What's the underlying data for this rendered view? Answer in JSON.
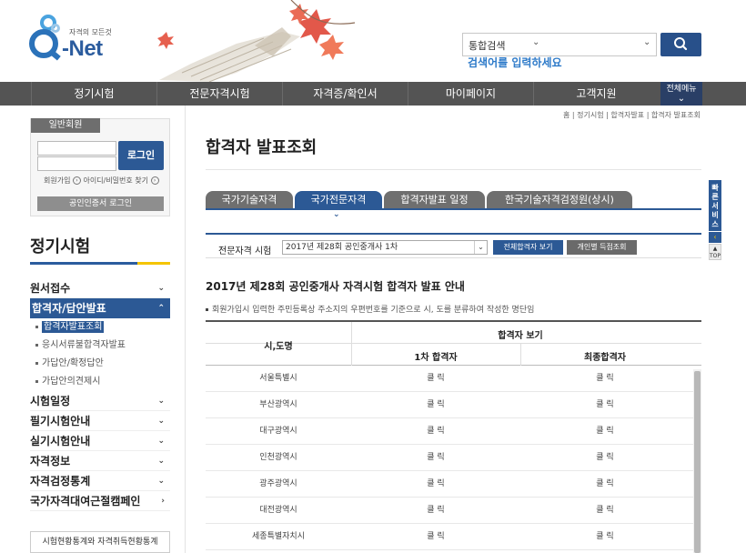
{
  "logo": {
    "slogan": "자격의 모든것",
    "name": "-Net"
  },
  "search": {
    "category": "통합검색",
    "placeholder": "검색어를 입력하세요"
  },
  "gnb": {
    "items": [
      "정기시험",
      "전문자격시험",
      "자격증/확인서",
      "마이페이지",
      "고객지원"
    ],
    "all_menu": "전체메뉴"
  },
  "login": {
    "member_tab": "일반회원",
    "login_button": "로그인",
    "join_link": "회원가입",
    "find_link": "아이디/비밀번호 찾기",
    "cert_login": "공인인증서 로그인"
  },
  "lnb": {
    "title": "정기시험",
    "items": [
      {
        "label": "원서접수",
        "chev": "⌄"
      },
      {
        "label": "합격자/답안발표",
        "chev": "⌃"
      }
    ],
    "subitems": [
      "합격자발표조회",
      "응시서류불합격자발표",
      "가답안/확정답안",
      "가답안의견제시"
    ],
    "items_after": [
      {
        "label": "시험일정",
        "chev": "⌄"
      },
      {
        "label": "필기시험안내",
        "chev": "⌄"
      },
      {
        "label": "실기시험안내",
        "chev": "⌄"
      },
      {
        "label": "자격정보",
        "chev": "⌄"
      },
      {
        "label": "자격검정통계",
        "chev": "⌄"
      },
      {
        "label": "국가자격대여근절캠페인",
        "chev": "›"
      }
    ],
    "stats_link": "시험현황통계와 자격취득현황통계"
  },
  "breadcrumb": "홈 | 정기시험 | 합격자발표 | 합격자 발표조회",
  "page_title": "합격자 발표조회",
  "tabs": [
    "국가기술자격",
    "국가전문자격",
    "합격자발표 일정",
    "한국기술자격검정원(상시)"
  ],
  "filter": {
    "label": "전문자격 시험",
    "selected_exam": "2017년 제28회 공인중개사 1차",
    "view_all_button": "전체합격자 보기",
    "personal_button": "개인별 득점조회"
  },
  "notice": {
    "title": "2017년 제28회 공인중개사 자격시험 합격자 발표 안내",
    "description": "회원가입시 입력한 주민등록상 주소지의 우편번호를 기준으로 시, 도를 분류하여 작성한 명단임"
  },
  "table": {
    "col_region": "시,도명",
    "col_group": "합격자 보기",
    "col_first": "1차 합격자",
    "col_final": "최종합격자",
    "rows": [
      {
        "region": "서울특별시",
        "first": "클 릭",
        "final": "클 릭"
      },
      {
        "region": "부산광역시",
        "first": "클 릭",
        "final": "클 릭"
      },
      {
        "region": "대구광역시",
        "first": "클 릭",
        "final": "클 릭"
      },
      {
        "region": "인천광역시",
        "first": "클 릭",
        "final": "클 릭"
      },
      {
        "region": "광주광역시",
        "first": "클 릭",
        "final": "클 릭"
      },
      {
        "region": "대전광역시",
        "first": "클 릭",
        "final": "클 릭"
      },
      {
        "region": "세종특별자치시",
        "first": "클 릭",
        "final": "클 릭"
      }
    ]
  },
  "quick": {
    "label": "빠른서비스",
    "top": "TOP"
  },
  "colors": {
    "primary": "#2c5995",
    "nav": "#545454",
    "accent": "#f4c400",
    "link": "#2d7ac9"
  }
}
